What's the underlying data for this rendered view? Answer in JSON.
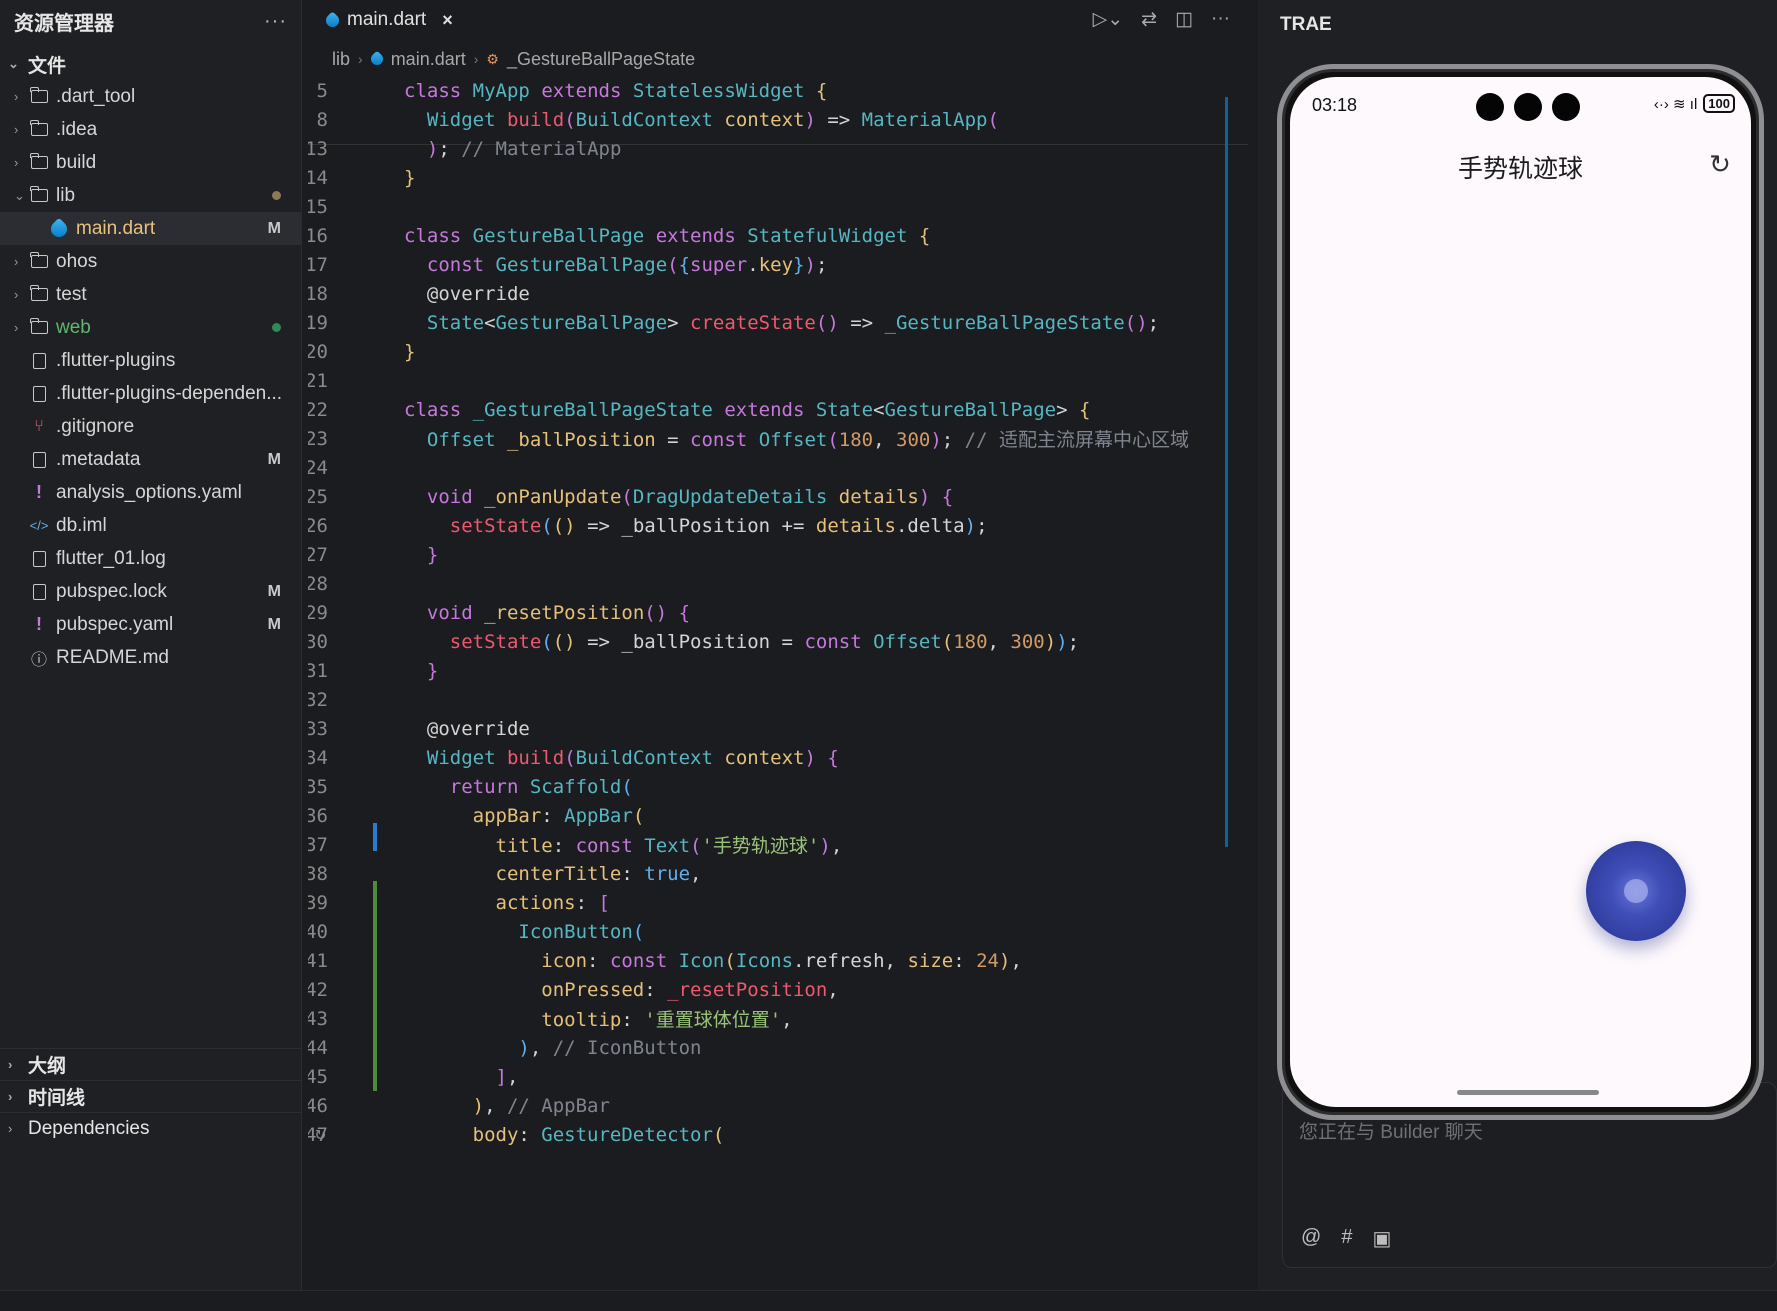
{
  "explorer": {
    "title": "资源管理器",
    "more": "···",
    "files_section": "文件",
    "items": [
      {
        "label": ".dart_tool",
        "kind": "folder",
        "badge": ""
      },
      {
        "label": ".idea",
        "kind": "folder",
        "badge": ""
      },
      {
        "label": "build",
        "kind": "folder",
        "badge": ""
      },
      {
        "label": "lib",
        "kind": "folder-open",
        "badge": ""
      },
      {
        "label": "main.dart",
        "kind": "dart",
        "badge": "M"
      },
      {
        "label": "ohos",
        "kind": "folder",
        "badge": ""
      },
      {
        "label": "test",
        "kind": "folder",
        "badge": ""
      },
      {
        "label": "web",
        "kind": "folder",
        "badge": ""
      },
      {
        "label": ".flutter-plugins",
        "kind": "file",
        "badge": ""
      },
      {
        "label": ".flutter-plugins-dependen...",
        "kind": "file",
        "badge": ""
      },
      {
        "label": ".gitignore",
        "kind": "git",
        "badge": ""
      },
      {
        "label": ".metadata",
        "kind": "file",
        "badge": "M"
      },
      {
        "label": "analysis_options.yaml",
        "kind": "yaml",
        "badge": ""
      },
      {
        "label": "db.iml",
        "kind": "xml",
        "badge": ""
      },
      {
        "label": "flutter_01.log",
        "kind": "file",
        "badge": ""
      },
      {
        "label": "pubspec.lock",
        "kind": "file",
        "badge": "M"
      },
      {
        "label": "pubspec.yaml",
        "kind": "yaml",
        "badge": "M"
      },
      {
        "label": "README.md",
        "kind": "info",
        "badge": ""
      }
    ],
    "bottom_sections": [
      "大纲",
      "时间线",
      "Dependencies"
    ]
  },
  "editor": {
    "tab_label": "main.dart",
    "tab_close": "×",
    "breadcrumb": [
      "lib",
      "main.dart",
      "_GestureBallPageState"
    ],
    "code_lines": [
      {
        "no": "5",
        "html": "<span class='k'>class</span> <span class='t'>MyApp</span> <span class='k'>extends</span> <span class='t'>StatelessWidget</span> <span class='y'>{</span>"
      },
      {
        "no": "8",
        "html": "  <span class='t'>Widget</span> <span class='fn'>build</span><span class='p'>(</span><span class='t'>BuildContext</span> <span class='f'>context</span><span class='p'>)</span> => <span class='t'>MaterialApp</span><span class='p'>(</span>"
      },
      {
        "no": "13",
        "html": "  <span class='p'>)</span>; <span class='c'>// MaterialApp</span>"
      },
      {
        "no": "14",
        "html": "<span class='y'>}</span>"
      },
      {
        "no": "15",
        "html": ""
      },
      {
        "no": "16",
        "html": "<span class='k'>class</span> <span class='t'>GestureBallPage</span> <span class='k'>extends</span> <span class='t'>StatefulWidget</span> <span class='y'>{</span>"
      },
      {
        "no": "17",
        "html": "  <span class='k'>const</span> <span class='t'>GestureBallPage</span><span class='p'>(</span><span class='b'>{</span><span class='k'>super</span>.<span class='f'>key</span><span class='b'>}</span><span class='p'>)</span>;"
      },
      {
        "no": "18",
        "html": "  <span class='w'>@override</span>"
      },
      {
        "no": "19",
        "html": "  <span class='t'>State</span>&lt;<span class='t'>GestureBallPage</span>&gt; <span class='fn'>createState</span><span class='p'>()</span> => <span class='t'>_GestureBallPageState</span><span class='p'>()</span>;"
      },
      {
        "no": "20",
        "html": "<span class='y'>}</span>"
      },
      {
        "no": "21",
        "html": ""
      },
      {
        "no": "22",
        "html": "<span class='k'>class</span> <span class='t'>_GestureBallPageState</span> <span class='k'>extends</span> <span class='t'>State</span>&lt;<span class='t'>GestureBallPage</span>&gt; <span class='y'>{</span>"
      },
      {
        "no": "23",
        "html": "  <span class='t'>Offset</span> <span class='f'>_ballPosition</span> = <span class='k'>const</span> <span class='t'>Offset</span><span class='p'>(</span><span class='n'>180</span>, <span class='n'>300</span><span class='p'>)</span>; <span class='c'>// 适配主流屏幕中心区域</span>"
      },
      {
        "no": "24",
        "html": ""
      },
      {
        "no": "25",
        "html": "  <span class='k'>void</span> <span class='f'>_onPanUpdate</span><span class='p'>(</span><span class='t'>DragUpdateDetails</span> <span class='f'>details</span><span class='p'>)</span> <span class='p'>{</span>"
      },
      {
        "no": "26",
        "html": "    <span class='fn'>setState</span><span class='b'>(</span><span class='y'>()</span> => <span class='w'>_ballPosition</span> += <span class='f'>details</span>.<span class='w'>delta</span><span class='b'>)</span>;"
      },
      {
        "no": "27",
        "html": "  <span class='p'>}</span>"
      },
      {
        "no": "28",
        "html": ""
      },
      {
        "no": "29",
        "html": "  <span class='k'>void</span> <span class='f'>_resetPosition</span><span class='p'>()</span> <span class='p'>{</span>"
      },
      {
        "no": "30",
        "html": "    <span class='fn'>setState</span><span class='b'>(</span><span class='y'>()</span> => <span class='w'>_ballPosition</span> = <span class='k'>const</span> <span class='t'>Offset</span><span class='y'>(</span><span class='n'>180</span>, <span class='n'>300</span><span class='y'>)</span><span class='b'>)</span>;"
      },
      {
        "no": "31",
        "html": "  <span class='p'>}</span>"
      },
      {
        "no": "32",
        "html": ""
      },
      {
        "no": "33",
        "html": "  <span class='w'>@override</span>"
      },
      {
        "no": "34",
        "html": "  <span class='t'>Widget</span> <span class='fn'>build</span><span class='p'>(</span><span class='t'>BuildContext</span> <span class='f'>context</span><span class='p'>)</span> <span class='p'>{</span>"
      },
      {
        "no": "35",
        "html": "    <span class='k'>return</span> <span class='t'>Scaffold</span><span class='b'>(</span>"
      },
      {
        "no": "36",
        "html": "      <span class='f'>appBar</span>: <span class='t'>AppBar</span><span class='y'>(</span>"
      },
      {
        "no": "37",
        "html": "        <span class='f'>title</span>: <span class='k'>const</span> <span class='t'>Text</span><span class='p'>(</span><span class='s'>'手势轨迹球'</span><span class='p'>)</span>,"
      },
      {
        "no": "38",
        "html": "        <span class='f'>centerTitle</span>: <span class='v'>true</span>,"
      },
      {
        "no": "39",
        "html": "        <span class='f'>actions</span>: <span class='p'>[</span>"
      },
      {
        "no": "40",
        "html": "          <span class='t'>IconButton</span><span class='b'>(</span>"
      },
      {
        "no": "41",
        "html": "            <span class='f'>icon</span>: <span class='k'>const</span> <span class='t'>Icon</span><span class='y'>(</span><span class='t'>Icons</span>.<span class='w'>refresh</span>, <span class='f'>size</span>: <span class='n'>24</span><span class='y'>)</span>,"
      },
      {
        "no": "42",
        "html": "            <span class='f'>onPressed</span>: <span class='fn'>_resetPosition</span>,"
      },
      {
        "no": "43",
        "html": "            <span class='f'>tooltip</span>: <span class='s'>'重置球体位置'</span>,"
      },
      {
        "no": "44",
        "html": "          <span class='b'>)</span>, <span class='c'>// IconButton</span>"
      },
      {
        "no": "45",
        "html": "        <span class='p'>]</span>,"
      },
      {
        "no": "46",
        "html": "      <span class='y'>)</span>, <span class='c'>// AppBar</span>"
      },
      {
        "no": "47",
        "html": "      <span class='f'>body</span>: <span class='t'>GestureDetector</span><span class='y'>(</span>"
      }
    ]
  },
  "right_panel": {
    "title": "TRAE",
    "chat_placeholder": "您正在与 Builder 聊天",
    "chat_icons": [
      "@",
      "#",
      "▣"
    ]
  },
  "phone": {
    "time": "03:18",
    "status_icons": "‹·› ≋ ıl",
    "battery": "100",
    "app_title": "手势轨迹球",
    "refresh_icon": "↻"
  }
}
